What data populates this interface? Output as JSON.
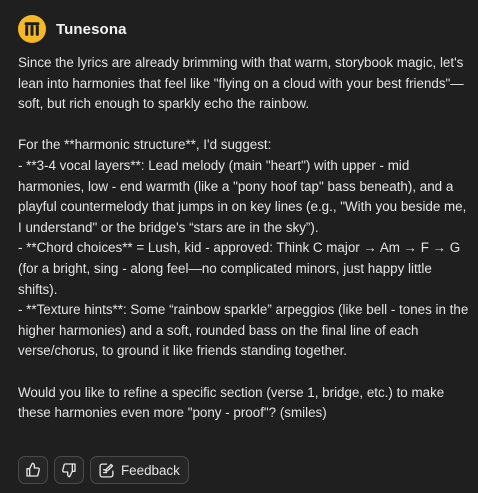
{
  "bot": {
    "name": "Tunesona",
    "avatar_icon": "tunesona-logo-icon",
    "avatar_color": "#f5b927"
  },
  "message": {
    "paragraphs": [
      "Since the lyrics are already brimming with that warm, storybook magic, let's lean into harmonies that feel like \"flying on a cloud with your best friends\"—soft, but rich enough to sparkly echo the rainbow.",
      "",
      "For the **harmonic structure**, I'd suggest:",
      "- **3-4 vocal layers**: Lead melody (main \"heart\") with upper - mid harmonies, low - end warmth (like a \"pony hoof tap\" bass beneath), and a playful countermelody that jumps in on key lines (e.g., \"With you beside me, I understand\" or the bridge's “stars are in the sky”).",
      "- **Chord choices** = Lush, kid - approved: Think C major → Am → F → G (for a bright, sing - along feel—no complicated minors, just happy little shifts).",
      "- **Texture hints**: Some “rainbow sparkle” arpeggios (like bell - tones in the higher harmonies) and a soft, rounded bass on the final line of each verse/chorus, to ground it like friends standing together.",
      "",
      "Would you like to refine a specific section (verse 1, bridge, etc.) to make these harmonies even more \"pony - proof\"? (smiles)"
    ]
  },
  "actions": {
    "like_icon": "thumbs-up-icon",
    "dislike_icon": "thumbs-down-icon",
    "feedback_icon": "feedback-icon",
    "feedback_label": "Feedback"
  }
}
